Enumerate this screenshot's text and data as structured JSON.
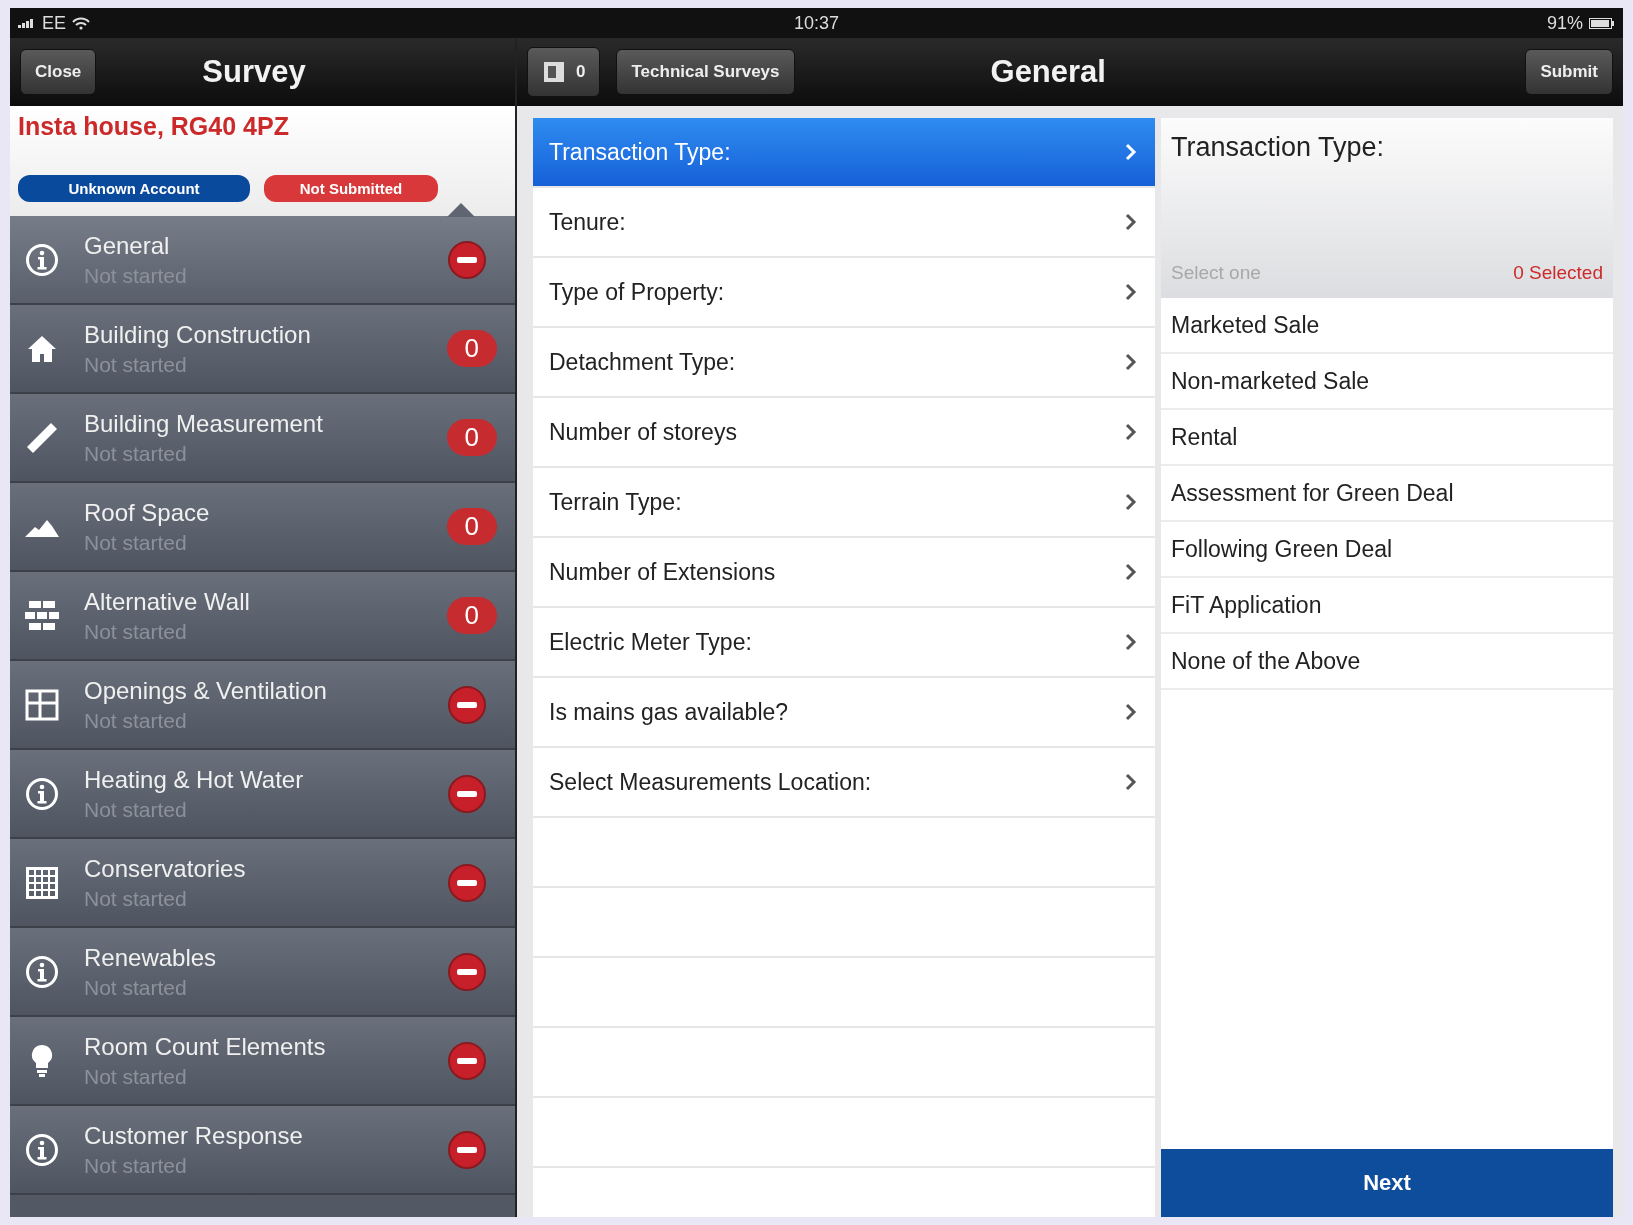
{
  "status_bar": {
    "carrier": "EE",
    "time": "10:37",
    "battery": "91%"
  },
  "sidebar_nav": {
    "close_button": "Close",
    "title": "Survey"
  },
  "main_nav": {
    "count_button": "0",
    "back_button": "Technical Surveys",
    "title": "General",
    "submit_button": "Submit"
  },
  "property": {
    "title": "Insta house, RG40 4PZ",
    "tags": [
      {
        "label": "Unknown Account",
        "color": "#0a4a9c"
      },
      {
        "label": "Not Submitted",
        "color": "#d9383a"
      }
    ]
  },
  "sections": [
    {
      "kind": "info",
      "title": "General",
      "status": "Not started",
      "badge": {
        "kind": "minus"
      },
      "selected": true
    },
    {
      "kind": "house",
      "title": "Building Construction",
      "status": "Not started",
      "badge": {
        "kind": "count",
        "text": "0"
      },
      "selected": false
    },
    {
      "kind": "ruler",
      "title": "Building Measurement",
      "status": "Not started",
      "badge": {
        "kind": "count",
        "text": "0"
      },
      "selected": false
    },
    {
      "kind": "roof",
      "title": "Roof Space",
      "status": "Not started",
      "badge": {
        "kind": "count",
        "text": "0"
      },
      "selected": false
    },
    {
      "kind": "bricks",
      "title": "Alternative Wall",
      "status": "Not started",
      "badge": {
        "kind": "count",
        "text": "0"
      },
      "selected": false
    },
    {
      "kind": "window",
      "title": "Openings & Ventilation",
      "status": "Not started",
      "badge": {
        "kind": "minus"
      },
      "selected": false
    },
    {
      "kind": "info",
      "title": "Heating & Hot Water",
      "status": "Not started",
      "badge": {
        "kind": "minus"
      },
      "selected": false
    },
    {
      "kind": "grid",
      "title": "Conservatories",
      "status": "Not started",
      "badge": {
        "kind": "minus"
      },
      "selected": false
    },
    {
      "kind": "info",
      "title": "Renewables",
      "status": "Not started",
      "badge": {
        "kind": "minus"
      },
      "selected": false
    },
    {
      "kind": "bulb",
      "title": "Room Count Elements",
      "status": "Not started",
      "badge": {
        "kind": "minus"
      },
      "selected": false
    },
    {
      "kind": "info",
      "title": "Customer Response",
      "status": "Not started",
      "badge": {
        "kind": "minus"
      },
      "selected": false
    }
  ],
  "questions": [
    {
      "label": "Transaction Type:",
      "selected": true
    },
    {
      "label": "Tenure:",
      "selected": false
    },
    {
      "label": "Type of Property:",
      "selected": false
    },
    {
      "label": "Detachment Type:",
      "selected": false
    },
    {
      "label": "Number of storeys",
      "selected": false
    },
    {
      "label": "Terrain Type:",
      "selected": false
    },
    {
      "label": "Number of Extensions",
      "selected": false
    },
    {
      "label": "Electric Meter Type:",
      "selected": false
    },
    {
      "label": "Is mains gas available?",
      "selected": false
    },
    {
      "label": "Select Measurements Location:",
      "selected": false
    }
  ],
  "answer_panel": {
    "title": "Transaction Type:",
    "hint": "Select one",
    "selected_count": "0 Selected",
    "options": [
      {
        "label": "Marketed Sale",
        "selected": false
      },
      {
        "label": "Non-marketed Sale",
        "selected": false
      },
      {
        "label": "Rental",
        "selected": false
      },
      {
        "label": "Assessment for Green Deal",
        "selected": false
      },
      {
        "label": "Following Green Deal",
        "selected": false
      },
      {
        "label": "FiT Application",
        "selected": false
      },
      {
        "label": "None of the Above",
        "selected": false
      }
    ],
    "next_button": "Next"
  }
}
